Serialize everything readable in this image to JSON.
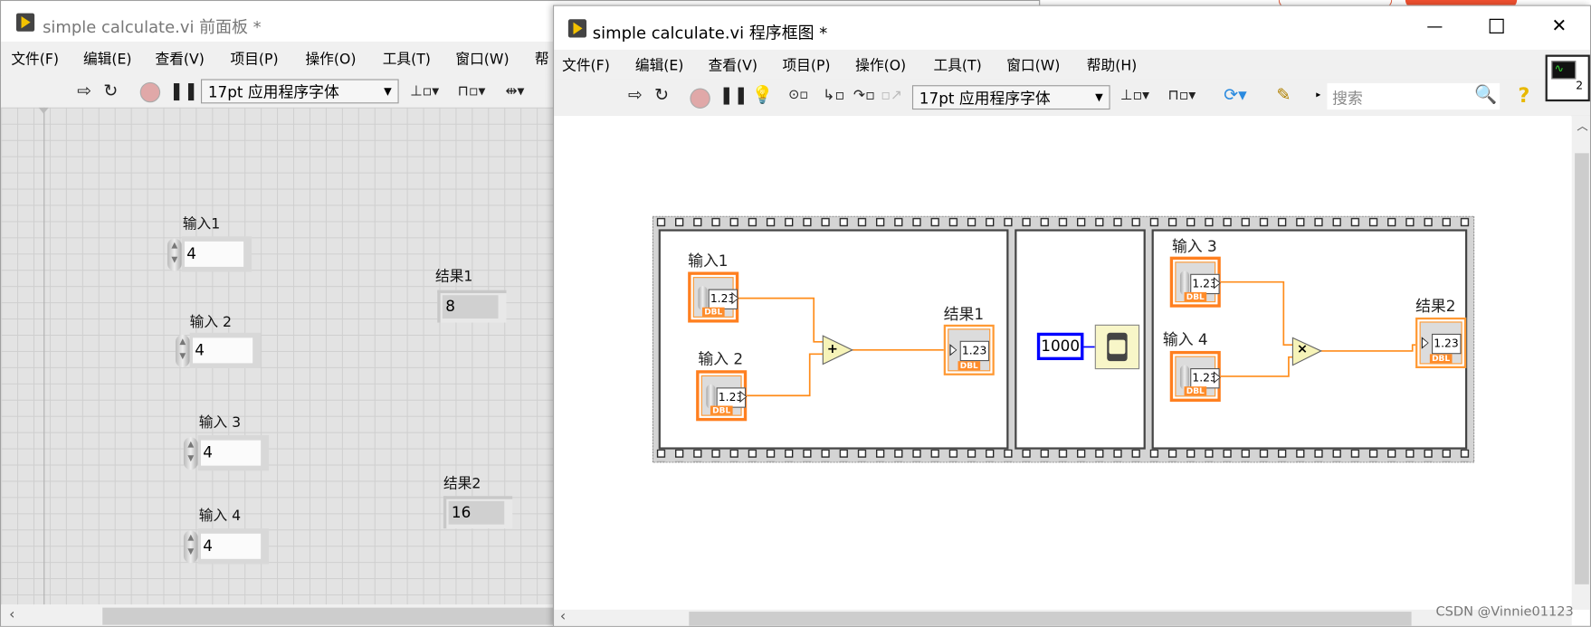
{
  "front_panel": {
    "title": "simple calculate.vi 前面板 *",
    "menu": [
      "文件(F)",
      "编辑(E)",
      "查看(V)",
      "项目(P)",
      "操作(O)",
      "工具(T)",
      "窗口(W)",
      "帮"
    ],
    "toolbar": {
      "font_select": "17pt 应用程序字体"
    },
    "controls": [
      {
        "label": "输入1",
        "value": "4"
      },
      {
        "label": "输入 2",
        "value": "4"
      },
      {
        "label": "输入 3",
        "value": "4"
      },
      {
        "label": "输入 4",
        "value": "4"
      }
    ],
    "indicators": [
      {
        "label": "结果1",
        "value": "8"
      },
      {
        "label": "结果2",
        "value": "16"
      }
    ]
  },
  "block_diagram": {
    "title": "simple calculate.vi 程序框图 *",
    "window_buttons": {
      "minimize": "—",
      "maximize": "☐",
      "close": "✕"
    },
    "menu": [
      "文件(F)",
      "编辑(E)",
      "查看(V)",
      "项目(P)",
      "操作(O)",
      "工具(T)",
      "窗口(W)",
      "帮助(H)"
    ],
    "toolbar": {
      "font_select": "17pt 应用程序字体",
      "search_placeholder": "搜索",
      "help": "?"
    },
    "vi_icon_number": "2",
    "terminal_display": "1.23",
    "terminal_type": "DBL",
    "frame1": {
      "inputs": [
        "输入1",
        "输入 2"
      ],
      "node": "+",
      "output": "结果1"
    },
    "frame2": {
      "constant": "1000"
    },
    "frame3": {
      "inputs": [
        "输入 3",
        "输入 4"
      ],
      "node": "×",
      "output": "结果2"
    },
    "wire_color": "#ff8c1a",
    "constant_color": "#0000ff"
  },
  "watermark": "CSDN @Vinnie01123"
}
